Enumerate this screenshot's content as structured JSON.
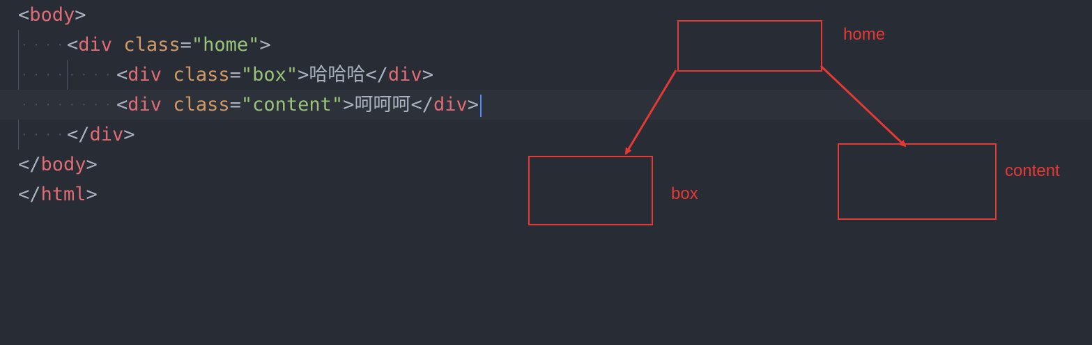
{
  "editor": {
    "lines": [
      {
        "indent": "",
        "parts": [
          {
            "t": "<",
            "c": "punct"
          },
          {
            "t": "body",
            "c": "tag"
          },
          {
            "t": ">",
            "c": "punct"
          }
        ]
      },
      {
        "indent": "····",
        "parts": [
          {
            "t": "<",
            "c": "punct"
          },
          {
            "t": "div",
            "c": "tag"
          },
          {
            "t": " ",
            "c": "text"
          },
          {
            "t": "class",
            "c": "attr"
          },
          {
            "t": "=",
            "c": "punct"
          },
          {
            "t": "\"home\"",
            "c": "str"
          },
          {
            "t": ">",
            "c": "punct"
          }
        ]
      },
      {
        "indent": "····",
        "parts": [
          {
            "t": "<",
            "c": "punct"
          },
          {
            "t": "div",
            "c": "tag"
          },
          {
            "t": " ",
            "c": "text"
          },
          {
            "t": "class",
            "c": "attr"
          },
          {
            "t": "=",
            "c": "punct"
          },
          {
            "t": "\"box\"",
            "c": "str"
          },
          {
            "t": ">",
            "c": "punct"
          },
          {
            "t": "哈哈哈",
            "c": "text"
          },
          {
            "t": "</",
            "c": "punct"
          },
          {
            "t": "div",
            "c": "tag"
          },
          {
            "t": ">",
            "c": "punct"
          }
        ]
      },
      {
        "indent": "····",
        "parts": [
          {
            "t": "<",
            "c": "punct"
          },
          {
            "t": "div",
            "c": "tag"
          },
          {
            "t": " ",
            "c": "text"
          },
          {
            "t": "class",
            "c": "attr"
          },
          {
            "t": "=",
            "c": "punct"
          },
          {
            "t": "\"content\"",
            "c": "str"
          },
          {
            "t": ">",
            "c": "punct"
          },
          {
            "t": "呵呵呵",
            "c": "text"
          },
          {
            "t": "</",
            "c": "punct"
          },
          {
            "t": "div",
            "c": "tag"
          },
          {
            "t": ">",
            "c": "punct"
          }
        ]
      },
      {
        "indent": "····",
        "parts": [
          {
            "t": "</",
            "c": "punct"
          },
          {
            "t": "div",
            "c": "tag"
          },
          {
            "t": ">",
            "c": "punct"
          }
        ]
      },
      {
        "indent": "",
        "parts": [
          {
            "t": "</",
            "c": "punct"
          },
          {
            "t": "body",
            "c": "tag"
          },
          {
            "t": ">",
            "c": "punct"
          }
        ]
      },
      {
        "indent": "",
        "parts": [
          {
            "t": "</",
            "c": "punct"
          },
          {
            "t": "html",
            "c": "tag"
          },
          {
            "t": ">",
            "c": "punct"
          }
        ]
      }
    ],
    "indent_dots_inner": "········",
    "active_line": 3
  },
  "annotation": {
    "color": "#e53935",
    "home_label": "home",
    "box_label": "box",
    "content_label": "content"
  },
  "theme": {
    "background": "#282c34",
    "tag": "#e06c75",
    "attr": "#d19a66",
    "string": "#98c379",
    "cursor": "#528bff"
  }
}
